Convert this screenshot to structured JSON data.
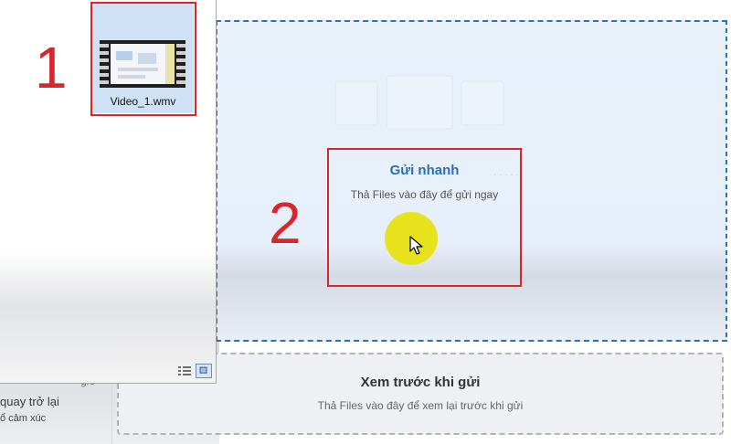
{
  "background_app": {
    "left_ghost_text": [
      "quay trở lại",
      "ổ cảm xúc",
      "giờ"
    ]
  },
  "quick_send": {
    "title": "Gửi nhanh",
    "subtitle": "Thả Files vào đây để gửi ngay"
  },
  "preview_send": {
    "title": "Xem trước khi gửi",
    "subtitle": "Thả Files vào đây để xem lại trước khi gửi"
  },
  "explorer": {
    "file": {
      "name": "Video_1.wmv",
      "icon": "video-file-thumbnail"
    },
    "view_buttons": [
      "details-view-icon",
      "large-icons-view-icon"
    ]
  },
  "annotations": {
    "step1": "1",
    "step2": "2",
    "color": "#d9262b"
  },
  "colors": {
    "accent": "#2a6fb6",
    "highlight": "#e6e21b"
  }
}
